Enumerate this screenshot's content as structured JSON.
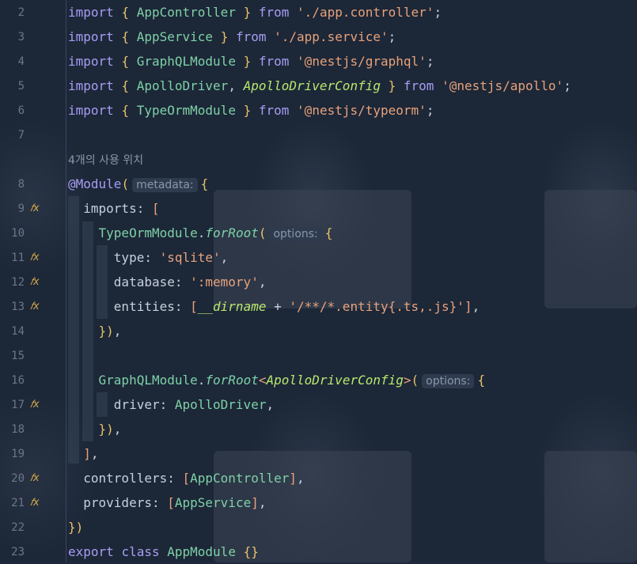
{
  "editor": {
    "lines": [
      {
        "n": "2"
      },
      {
        "n": "3"
      },
      {
        "n": "4"
      },
      {
        "n": "5"
      },
      {
        "n": "6"
      },
      {
        "n": "7"
      },
      {
        "n": "8"
      },
      {
        "n": "9"
      },
      {
        "n": "10"
      },
      {
        "n": "11"
      },
      {
        "n": "12"
      },
      {
        "n": "13"
      },
      {
        "n": "14"
      },
      {
        "n": "15"
      },
      {
        "n": "16"
      },
      {
        "n": "17"
      },
      {
        "n": "18"
      },
      {
        "n": "19"
      },
      {
        "n": "20"
      },
      {
        "n": "21"
      },
      {
        "n": "22"
      },
      {
        "n": "23"
      }
    ],
    "usage_hint": "4개의 사용 위치",
    "inlay_metadata": "metadata:",
    "inlay_options": "options:",
    "fx_marker": "f",
    "tokens": {
      "import": "import",
      "from": "from",
      "lb": "{",
      "rb": "}",
      "app_controller": "AppController",
      "app_service": "AppService",
      "graphql_module": "GraphQLModule",
      "apollo_driver": "ApolloDriver",
      "apollo_driver_config": "ApolloDriverConfig",
      "typeorm_module": "TypeOrmModule",
      "s_app_controller": "'./app.controller'",
      "s_app_service": "'./app.service'",
      "s_graphql": "'@nestjs/graphql'",
      "s_apollo": "'@nestjs/apollo'",
      "s_typeorm": "'@nestjs/typeorm'",
      "module_decorator": "@Module",
      "imports_prop": "imports",
      "for_root": "forRoot",
      "type_prop": "type",
      "s_sqlite": "'sqlite'",
      "database_prop": "database",
      "s_memory": "':memory'",
      "entities_prop": "entities",
      "dirname": "__dirname",
      "s_entity_glob": "'/**/*.entity{.ts,.js}'",
      "driver_prop": "driver",
      "controllers_prop": "controllers",
      "providers_prop": "providers",
      "export_kw": "export",
      "class_kw": "class",
      "app_module": "AppModule"
    }
  },
  "colors": {
    "background": "#1c2738",
    "keyword": "#a79df2",
    "string": "#e8a27a",
    "class": "#7fd1a6",
    "bracket": "#e8c268",
    "line_number": "#6b7689"
  }
}
